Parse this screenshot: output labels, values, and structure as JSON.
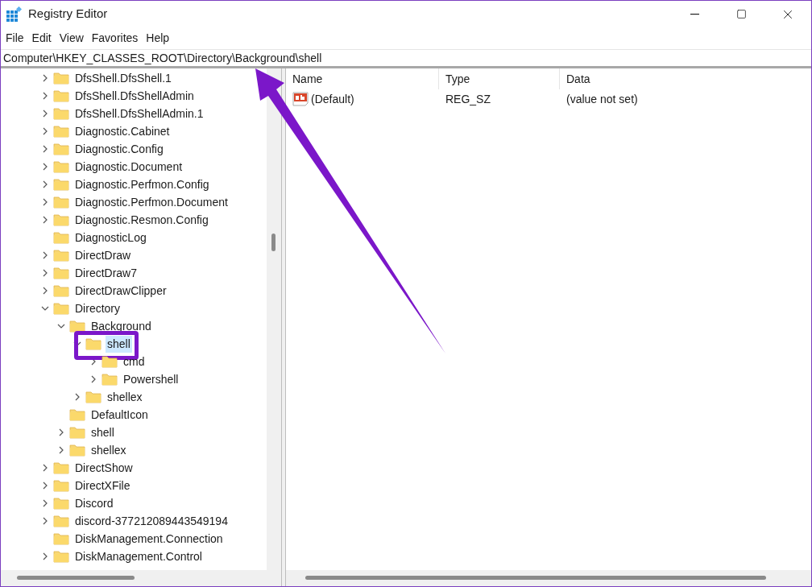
{
  "window": {
    "title": "Registry Editor"
  },
  "menu": [
    "File",
    "Edit",
    "View",
    "Favorites",
    "Help"
  ],
  "address": "Computer\\HKEY_CLASSES_ROOT\\Directory\\Background\\shell",
  "tree": [
    {
      "label": "DfsShell.DfsShell.1",
      "kind": "expandable",
      "expanded": false,
      "selected": false
    },
    {
      "label": "DfsShell.DfsShellAdmin",
      "kind": "expandable",
      "expanded": false,
      "selected": false
    },
    {
      "label": "DfsShell.DfsShellAdmin.1",
      "kind": "expandable",
      "expanded": false,
      "selected": false
    },
    {
      "label": "Diagnostic.Cabinet",
      "kind": "expandable",
      "expanded": false,
      "selected": false
    },
    {
      "label": "Diagnostic.Config",
      "kind": "expandable",
      "expanded": false,
      "selected": false
    },
    {
      "label": "Diagnostic.Document",
      "kind": "expandable",
      "expanded": false,
      "selected": false
    },
    {
      "label": "Diagnostic.Perfmon.Config",
      "kind": "expandable",
      "expanded": false,
      "selected": false
    },
    {
      "label": "Diagnostic.Perfmon.Document",
      "kind": "expandable",
      "expanded": false,
      "selected": false
    },
    {
      "label": "Diagnostic.Resmon.Config",
      "kind": "expandable",
      "expanded": false,
      "selected": false
    },
    {
      "label": "DiagnosticLog",
      "kind": "leaf",
      "selected": false
    },
    {
      "label": "DirectDraw",
      "kind": "expandable",
      "expanded": false,
      "selected": false
    },
    {
      "label": "DirectDraw7",
      "kind": "expandable",
      "expanded": false,
      "selected": false
    },
    {
      "label": "DirectDrawClipper",
      "kind": "expandable",
      "expanded": false,
      "selected": false
    },
    {
      "label": "Directory",
      "kind": "expandable",
      "expanded": true,
      "selected": false,
      "children": [
        {
          "label": "Background",
          "kind": "expandable",
          "expanded": true,
          "selected": false,
          "children": [
            {
              "label": "shell",
              "kind": "expandable",
              "expanded": true,
              "selected": true,
              "callout": true,
              "children": [
                {
                  "label": "cmd",
                  "kind": "expandable",
                  "expanded": false,
                  "selected": false
                },
                {
                  "label": "Powershell",
                  "kind": "expandable",
                  "expanded": false,
                  "selected": false
                }
              ]
            },
            {
              "label": "shellex",
              "kind": "expandable",
              "expanded": false,
              "selected": false
            }
          ]
        },
        {
          "label": "DefaultIcon",
          "kind": "leaf",
          "selected": false
        },
        {
          "label": "shell",
          "kind": "expandable",
          "expanded": false,
          "selected": false
        },
        {
          "label": "shellex",
          "kind": "expandable",
          "expanded": false,
          "selected": false
        }
      ]
    },
    {
      "label": "DirectShow",
      "kind": "expandable",
      "expanded": false,
      "selected": false
    },
    {
      "label": "DirectXFile",
      "kind": "expandable",
      "expanded": false,
      "selected": false
    },
    {
      "label": "Discord",
      "kind": "expandable",
      "expanded": false,
      "selected": false
    },
    {
      "label": "discord-377212089443549194",
      "kind": "expandable",
      "expanded": false,
      "selected": false
    },
    {
      "label": "DiskManagement.Connection",
      "kind": "leaf",
      "selected": false
    },
    {
      "label": "DiskManagement.Control",
      "kind": "expandable",
      "expanded": false,
      "selected": false
    }
  ],
  "values": {
    "columns": [
      "Name",
      "Type",
      "Data"
    ],
    "rows": [
      {
        "name": "(Default)",
        "type": "REG_SZ",
        "data": "(value not set)"
      }
    ]
  }
}
